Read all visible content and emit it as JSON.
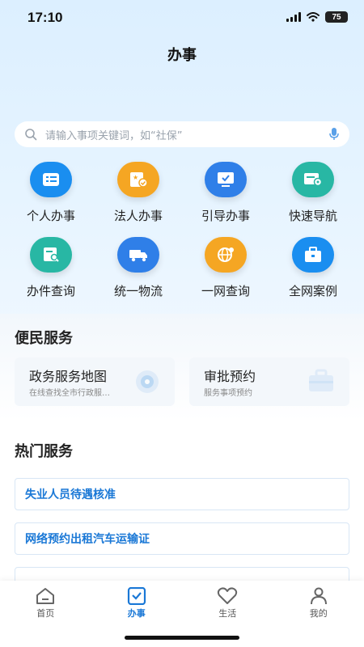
{
  "status": {
    "time": "17:10",
    "battery": "75"
  },
  "header": {
    "title": "办事"
  },
  "search": {
    "placeholder": "请输入事项关键词，如“社保”"
  },
  "services": [
    {
      "label": "个人办事",
      "icon": "person-card-icon",
      "color": "#1a8ef0"
    },
    {
      "label": "法人办事",
      "icon": "badge-check-icon",
      "color": "#f5a623"
    },
    {
      "label": "引导办事",
      "icon": "monitor-check-icon",
      "color": "#2f7fe8"
    },
    {
      "label": "快速导航",
      "icon": "map-location-icon",
      "color": "#28b7a4"
    },
    {
      "label": "办件查询",
      "icon": "document-search-icon",
      "color": "#28b7a4"
    },
    {
      "label": "统一物流",
      "icon": "truck-icon",
      "color": "#2f7fe8"
    },
    {
      "label": "一网查询",
      "icon": "globe-icon",
      "color": "#f5a623"
    },
    {
      "label": "全网案例",
      "icon": "briefcase-icon",
      "color": "#1a8ef0"
    }
  ],
  "convenience": {
    "title": "便民服务",
    "cards": [
      {
        "title": "政务服务地图",
        "subtitle": "在线查找全市行政服…",
        "icon": "map-pin-icon"
      },
      {
        "title": "审批预约",
        "subtitle": "服务事项预约",
        "icon": "briefcase-icon"
      }
    ]
  },
  "hot": {
    "title": "热门服务",
    "items": [
      "失业人员待遇核准",
      "网络预约出租汽车运输证"
    ]
  },
  "tabbar": {
    "tabs": [
      {
        "label": "首页",
        "icon": "home-icon"
      },
      {
        "label": "办事",
        "icon": "checkbox-icon",
        "active": true
      },
      {
        "label": "生活",
        "icon": "heart-icon"
      },
      {
        "label": "我的",
        "icon": "user-icon"
      }
    ]
  }
}
